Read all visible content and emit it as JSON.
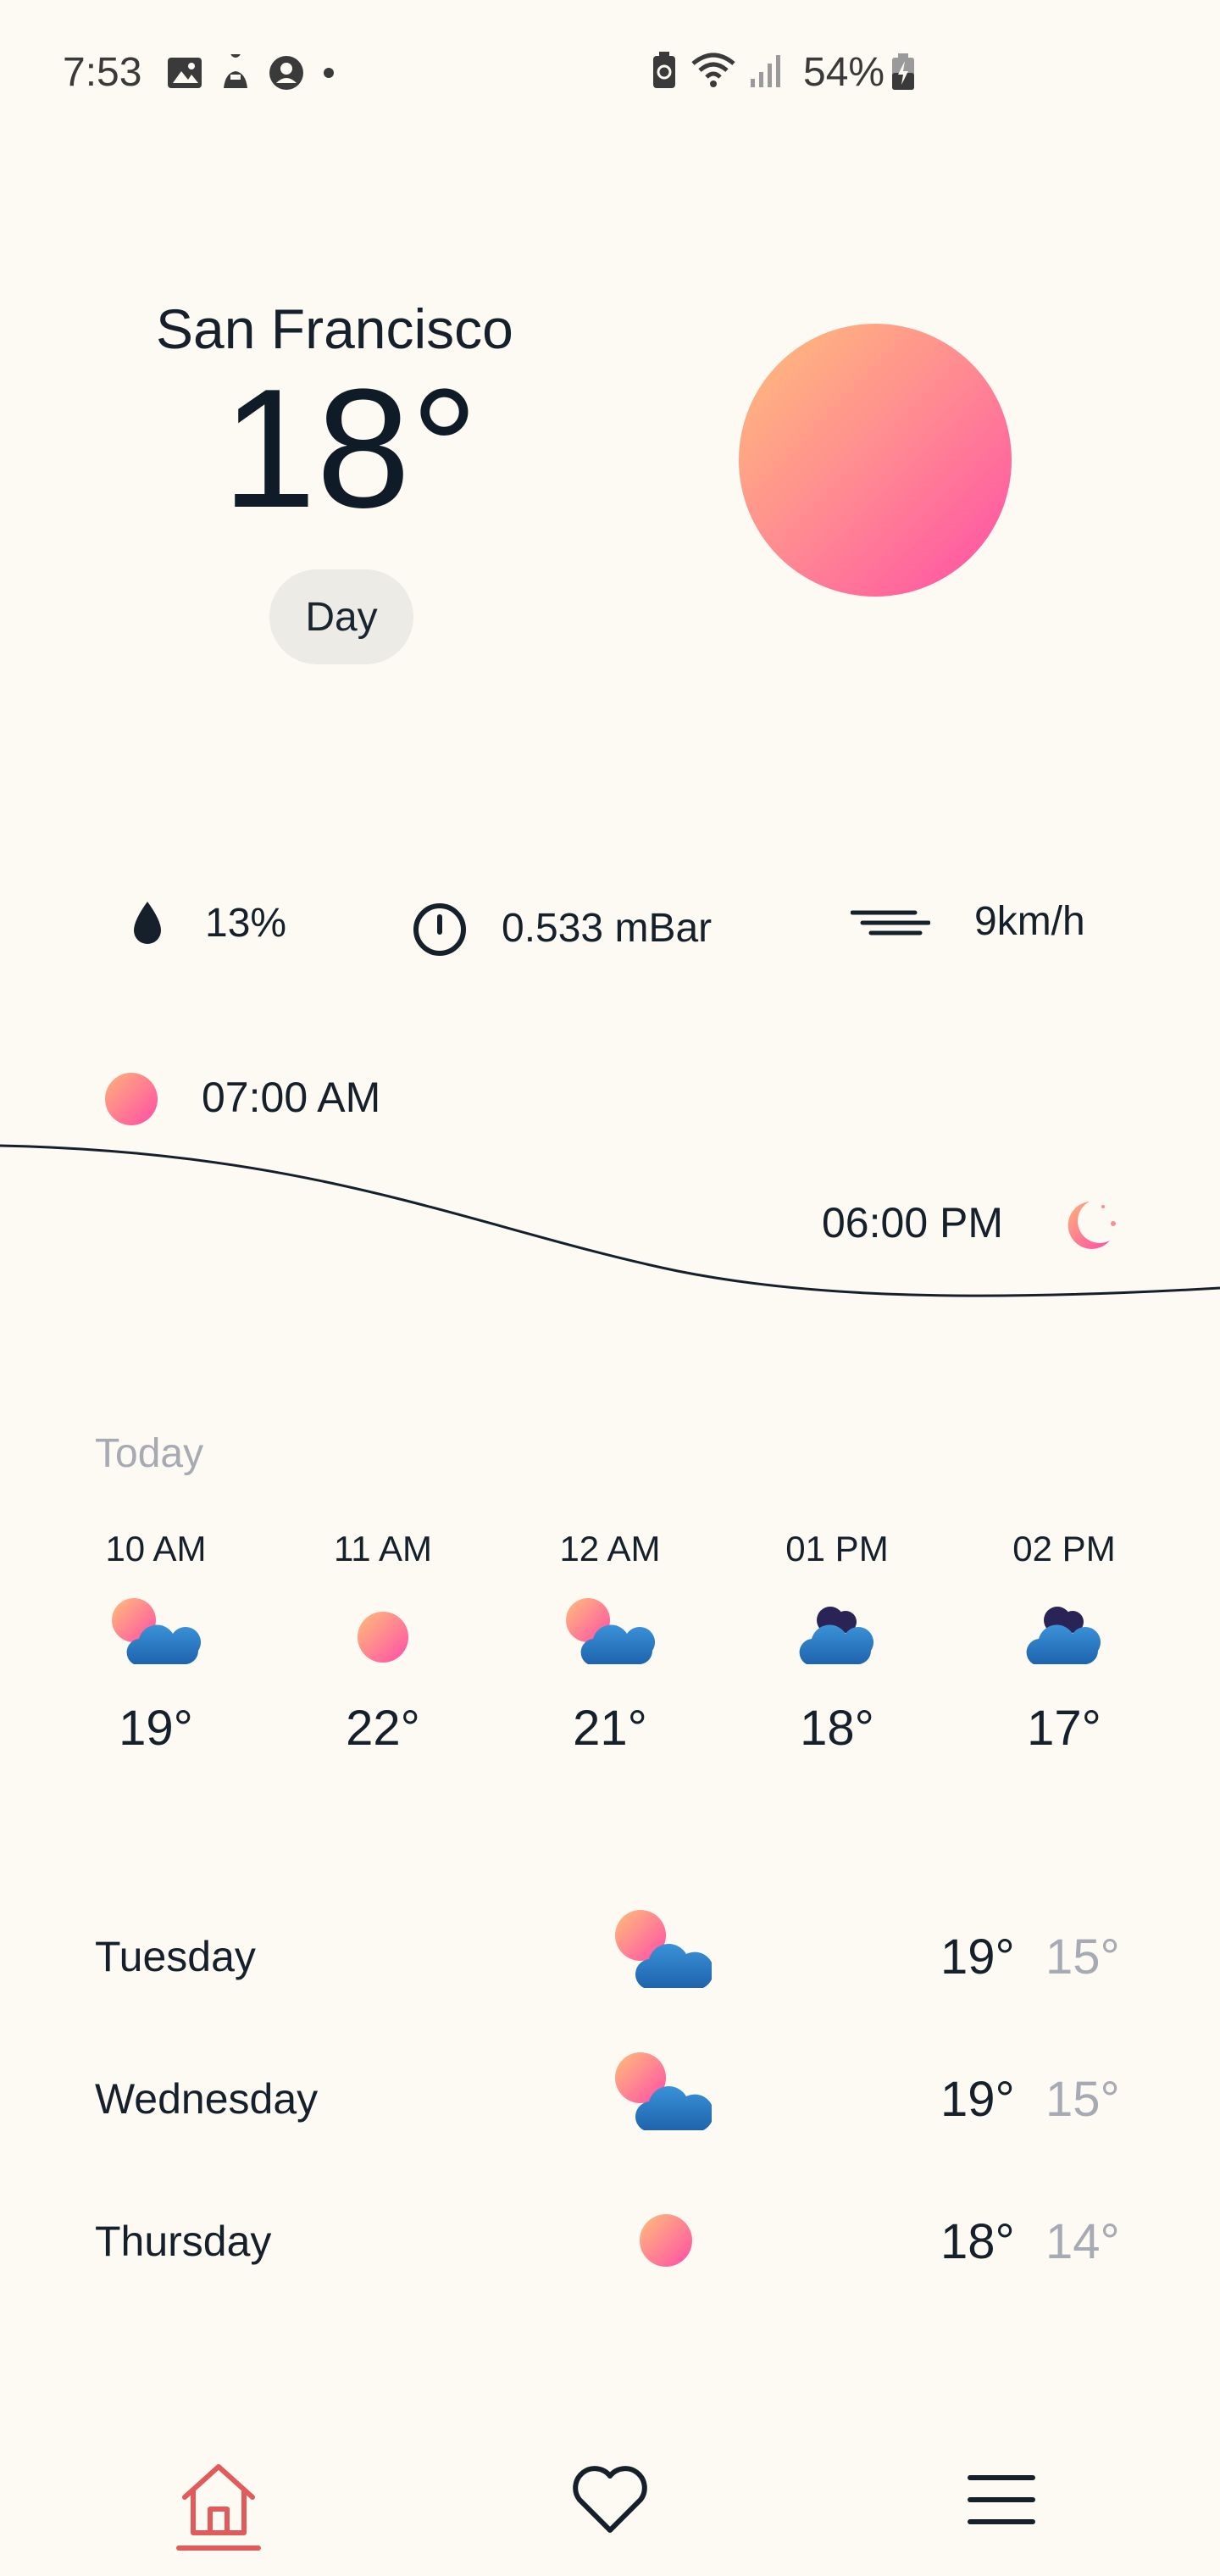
{
  "status_bar": {
    "time": "7:53",
    "battery_percent": "54%",
    "icons_left": [
      "gallery-icon",
      "hand-icon",
      "account-icon",
      "dot-icon"
    ],
    "icons_right": [
      "battery-saver-icon",
      "wifi-icon",
      "signal-icon",
      "battery-icon"
    ]
  },
  "weather": {
    "city": "San Francisco",
    "temperature": "18°",
    "period": "Day"
  },
  "stats": {
    "humidity": "13%",
    "pressure": "0.533 mBar",
    "wind": "9km/h"
  },
  "sun": {
    "sunrise": "07:00 AM",
    "sunset": "06:00 PM"
  },
  "today": {
    "label": "Today",
    "hours": [
      {
        "time": "10 AM",
        "temp": "19°",
        "icon": "sun-cloud-icon"
      },
      {
        "time": "11 AM",
        "temp": "22°",
        "icon": "sun-icon"
      },
      {
        "time": "12 AM",
        "temp": "21°",
        "icon": "sun-cloud-icon"
      },
      {
        "time": "01 PM",
        "temp": "18°",
        "icon": "cloud-icon"
      },
      {
        "time": "02 PM",
        "temp": "17°",
        "icon": "cloud-icon"
      }
    ]
  },
  "forecast": [
    {
      "day": "Tuesday",
      "high": "19°",
      "low": "15°",
      "icon": "sun-cloud-icon"
    },
    {
      "day": "Wednesday",
      "high": "19°",
      "low": "15°",
      "icon": "sun-cloud-icon"
    },
    {
      "day": "Thursday",
      "high": "18°",
      "low": "14°",
      "icon": "sun-icon"
    }
  ],
  "nav": {
    "items": [
      "home-icon",
      "heart-icon",
      "menu-icon"
    ],
    "active": "home-icon",
    "accent": "#e25b5b"
  },
  "colors": {
    "background": "#fcfaf2",
    "sun_gradient_start": "#ffbf7a",
    "sun_gradient_end": "#ff4da6",
    "cloud": "#2a7fc8",
    "muted_text": "#a7aab3"
  }
}
